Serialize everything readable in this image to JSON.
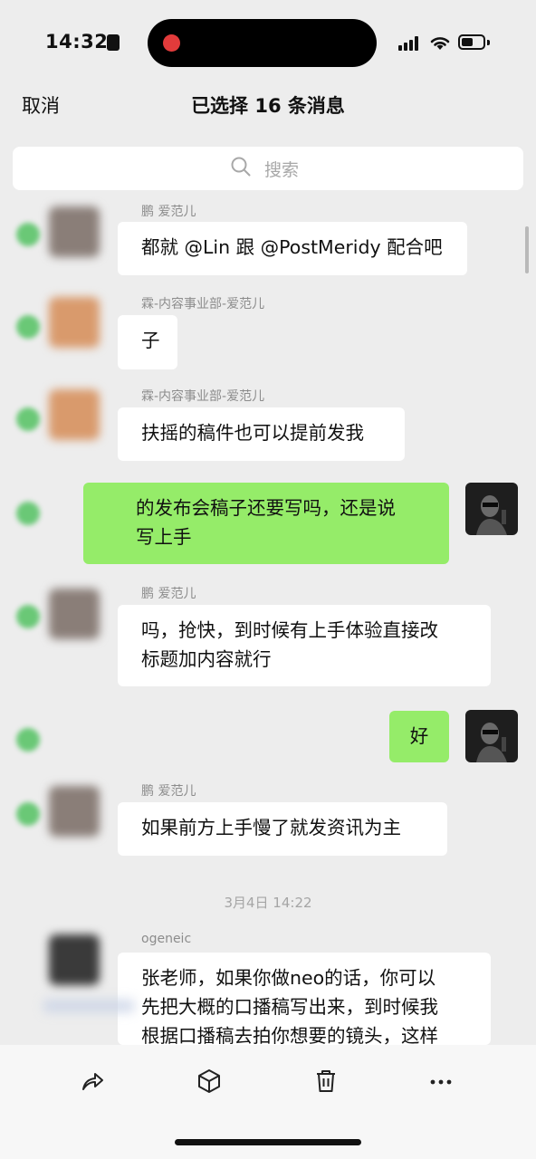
{
  "status_bar": {
    "time": "14:32"
  },
  "header": {
    "cancel_label": "取消",
    "title": "已选择 16 条消息"
  },
  "search": {
    "placeholder": "搜索"
  },
  "messages": [
    {
      "sender": "鹏 爱范儿",
      "text": "都就 @Lin 跟 @PostMeridy 配合吧"
    },
    {
      "sender": "霖-内容事业部-爱范儿",
      "text": "子"
    },
    {
      "sender": "霖-内容事业部-爱范儿",
      "text": "扶摇的稿件也可以提前发我"
    },
    {
      "text": "的发布会稿子还要写吗，还是说\n写上手"
    },
    {
      "sender": "鹏 爱范儿",
      "text": "吗，抢快，到时候有上手体验直接改\n标题加内容就行"
    },
    {
      "text": "好"
    },
    {
      "sender": "鹏 爱范儿",
      "text": "如果前方上手慢了就发资讯为主"
    },
    {
      "sender": "ogeneic",
      "text": "张老师，如果你做neo的话，你可以\n先把大概的口播稿写出来，到时候我\n根据口播稿去拍你想要的镜头，这样"
    }
  ],
  "timestamp": "3月4日 14:22",
  "toolbar": {
    "items": [
      {
        "icon": "share-icon"
      },
      {
        "icon": "box-icon"
      },
      {
        "icon": "trash-icon"
      },
      {
        "icon": "more-icon"
      }
    ]
  },
  "colors": {
    "my_bubble": "#95ec69",
    "check": "#5cc46a",
    "background": "#ededed"
  }
}
